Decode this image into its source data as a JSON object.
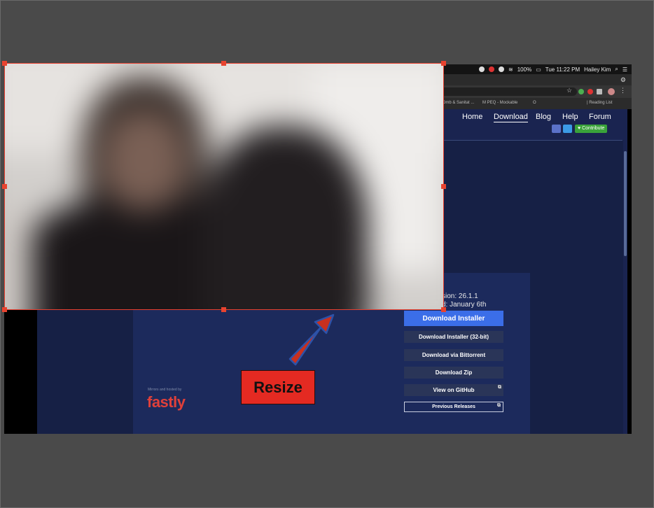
{
  "menubar": {
    "time": "Tue 11:22 PM",
    "user": "Hailey Kim",
    "battery": "100%"
  },
  "bookmarks": [
    "Dmb & Sanitat ...",
    "M PEQ - Mockable",
    "O"
  ],
  "bookmarks_right": "| Reading List",
  "nav": {
    "links": [
      "Home",
      "Download",
      "Blog",
      "Help",
      "Forum"
    ],
    "active": "Download",
    "contribute": "Contribute"
  },
  "release": {
    "version_text": "sion: 26.1.1",
    "released_text": "d: January 6th"
  },
  "buttons": {
    "installer": "Download Installer",
    "installer32": "Download Installer (32-bit)",
    "bittorrent": "Download via Bittorrent",
    "zip": "Download Zip",
    "github": "View on GitHub",
    "previous": "Previous Releases"
  },
  "sponsor": {
    "tagline": "Mirrors and hosted by",
    "name": "fastly"
  },
  "annotation": {
    "label": "Resize",
    "color": "#e42a22"
  },
  "colors": {
    "page_bg": "#162045",
    "primary_button": "#3b6ee8",
    "contribute": "#3aa33a",
    "fastly": "#e0403a",
    "selection": "#e84030"
  },
  "icons": {
    "discord": "discord-icon",
    "twitter": "twitter-icon",
    "heart": "heart-icon",
    "external": "external-link-icon"
  }
}
